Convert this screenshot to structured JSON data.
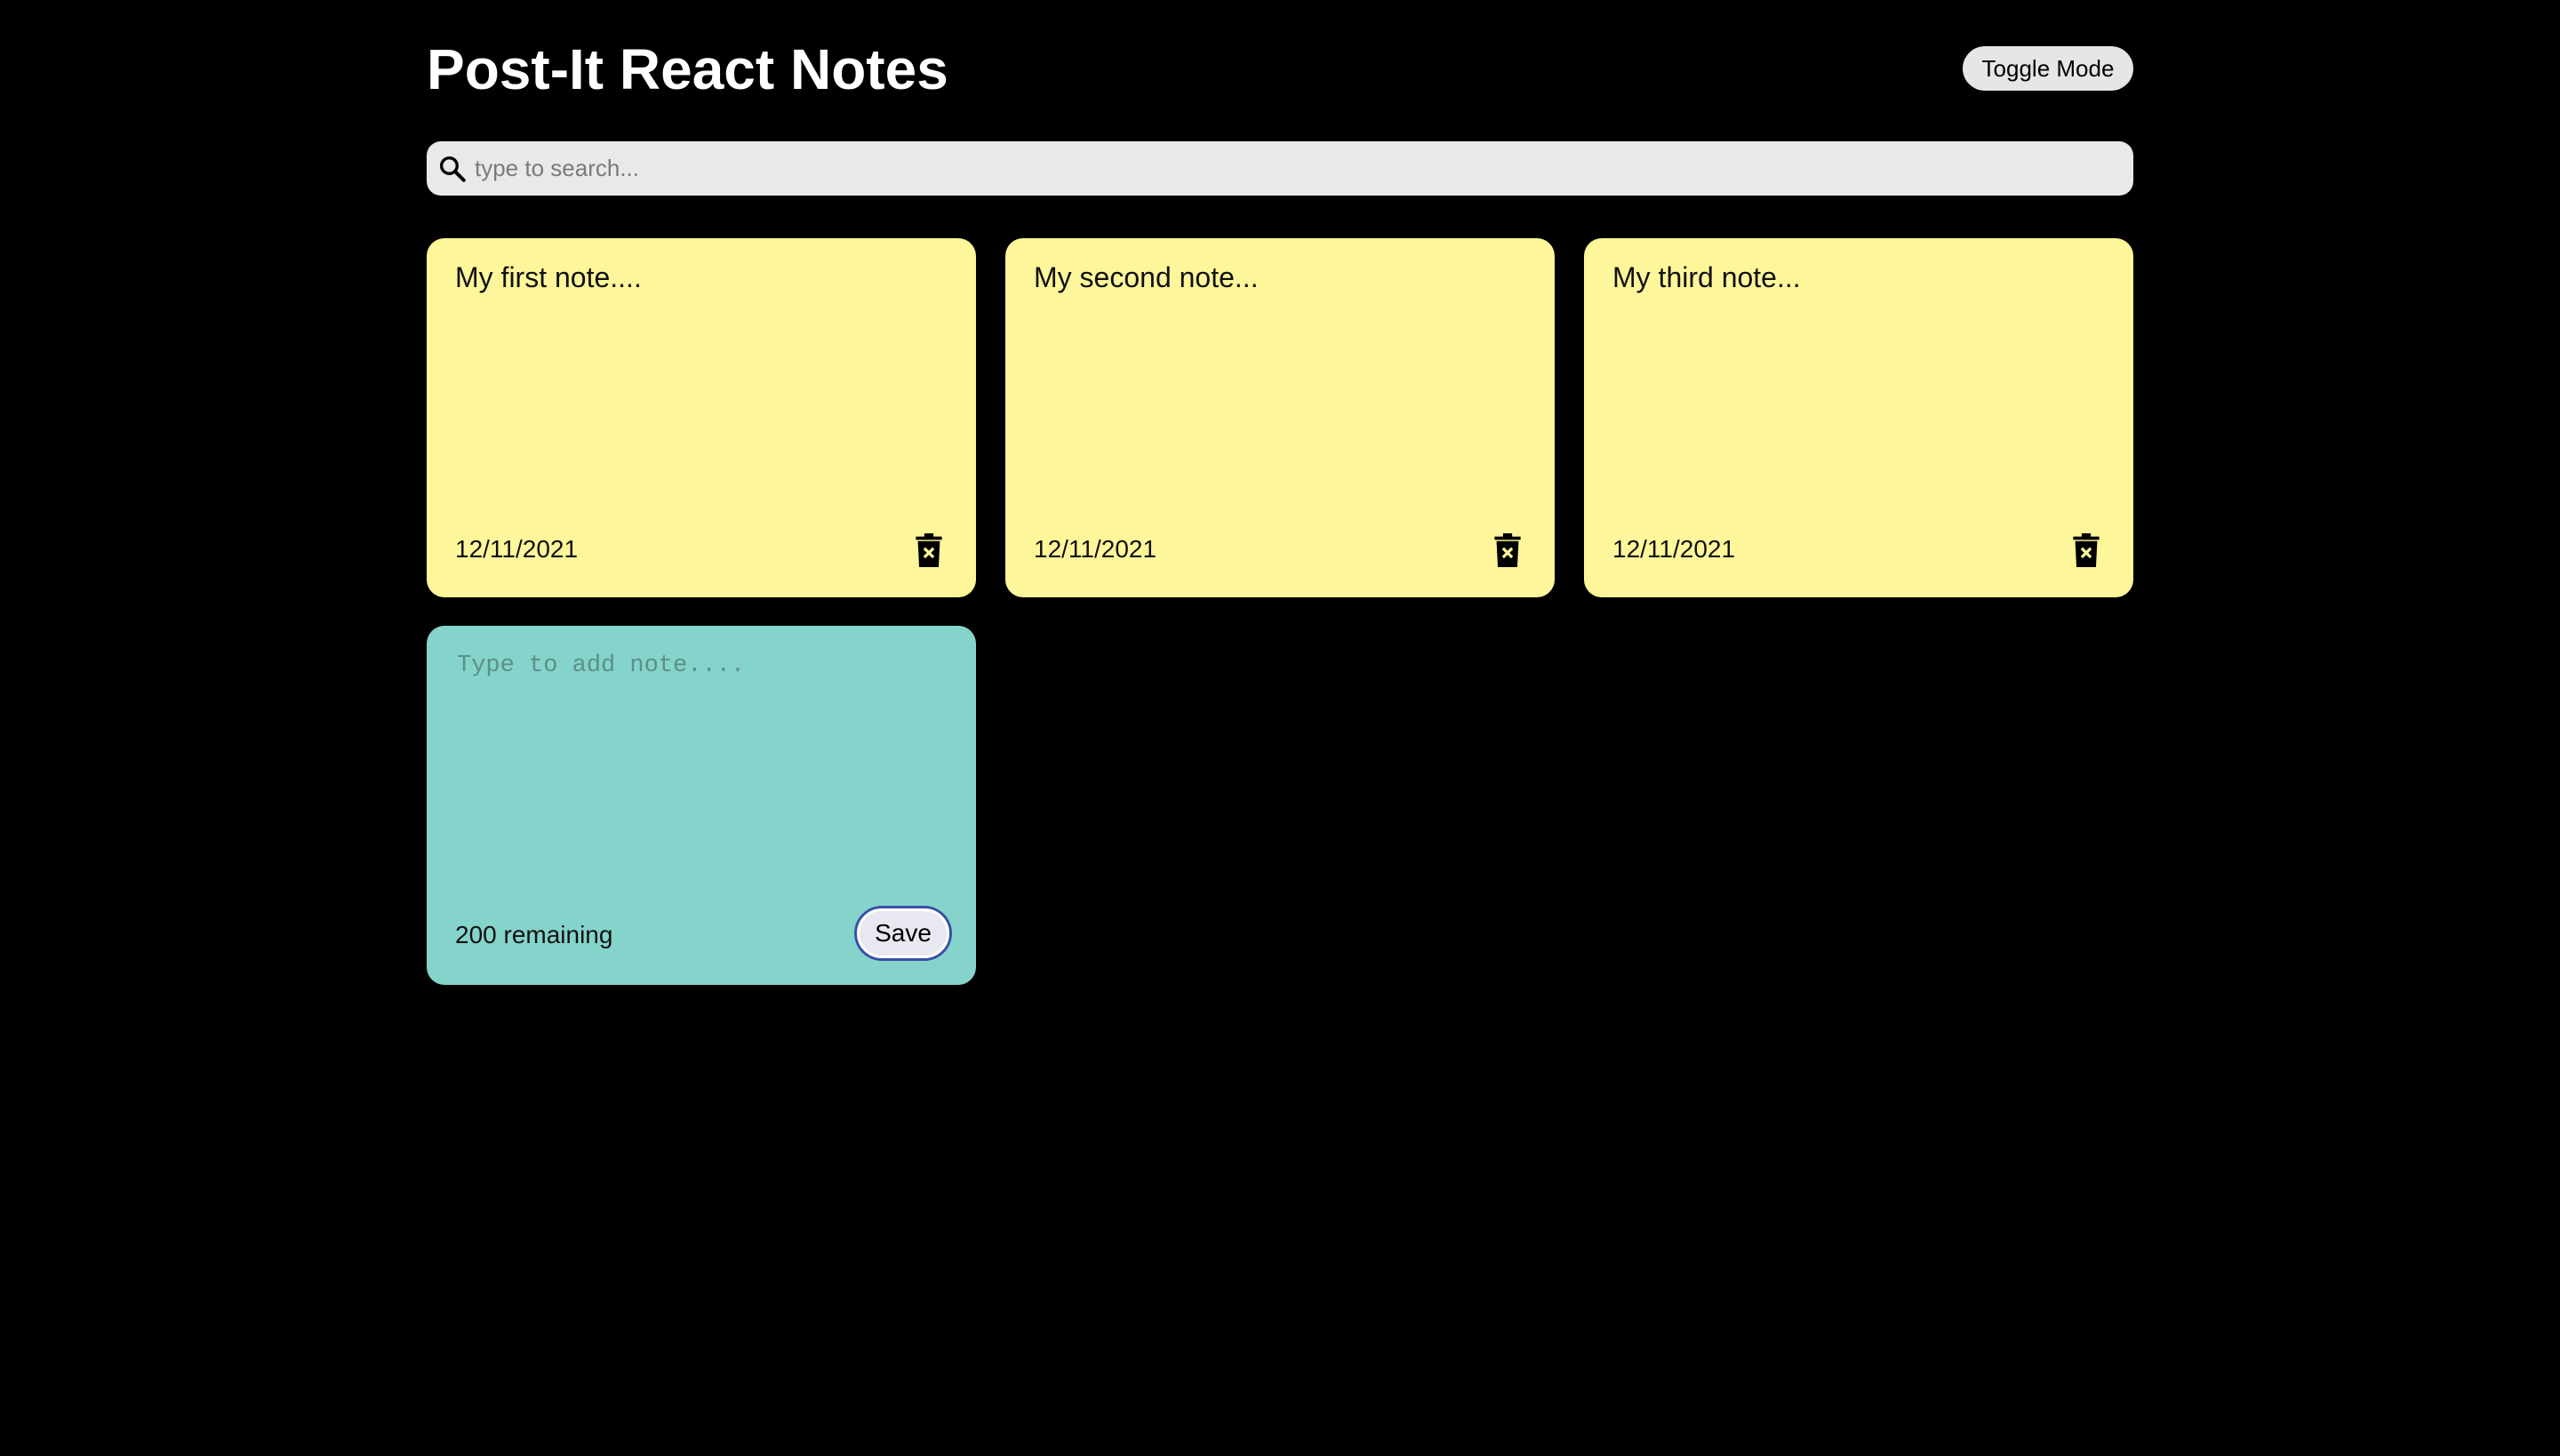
{
  "app": {
    "title": "Post-It React Notes",
    "toggle_label": "Toggle Mode"
  },
  "search": {
    "placeholder": "type to search...",
    "icon": "search-icon"
  },
  "notes": [
    {
      "text": "My first note....",
      "date": "12/11/2021"
    },
    {
      "text": "My second note...",
      "date": "12/11/2021"
    },
    {
      "text": "My third note...",
      "date": "12/11/2021"
    }
  ],
  "add_note": {
    "placeholder": "Type to add note....",
    "remaining_label": "200 remaining",
    "save_label": "Save"
  },
  "colors": {
    "background": "#000000",
    "note": "#fef69a",
    "new_note": "#85d4cb",
    "search": "#e9e9e9"
  }
}
